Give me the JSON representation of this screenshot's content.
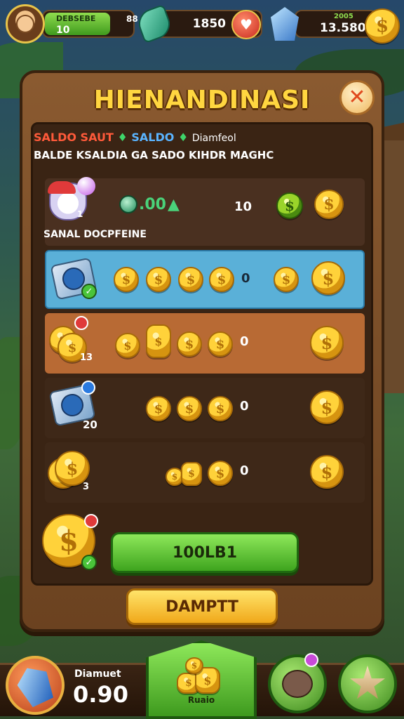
{
  "hud": {
    "xp_title": "DEBSEBE",
    "xp_count": "88",
    "xp_level": "10",
    "xp_progress": 0.75,
    "resource_value": "1850",
    "coin_small": "2005",
    "coin_value": "13.580"
  },
  "panel": {
    "title": "HIENANDINASI",
    "tab_red": "SALDO SAUT",
    "tab_sep1": "♦",
    "tab_blue": "SALDO",
    "tab_sep2": "♦",
    "tab_white": "Diamfeol",
    "subtitle": "BALDE KSALDIA GA SADO KIHDR MAGHC"
  },
  "rows": [
    {
      "rate": ".00",
      "value": "10",
      "label": "SANAL DOCPFEINE",
      "item_number": "1"
    },
    {
      "value": "0"
    },
    {
      "value": "0",
      "item_number": "13"
    },
    {
      "value": "0",
      "item_number": "20"
    },
    {
      "value": "0",
      "item_number": "3"
    }
  ],
  "actions": {
    "total_label": "100LB1",
    "deposit_label": "DAMPTT"
  },
  "bottom": {
    "balance_label": "Diamuet",
    "balance_value": "0.90",
    "main_tab_label": "Ruaio"
  },
  "colors": {
    "panel": "#8a5a30",
    "title": "#ffd640",
    "highlight_row": "#5ab0d8",
    "orange_row": "#b86a34",
    "green_button": "#3ea41e",
    "yellow_button": "#f0a81a"
  }
}
